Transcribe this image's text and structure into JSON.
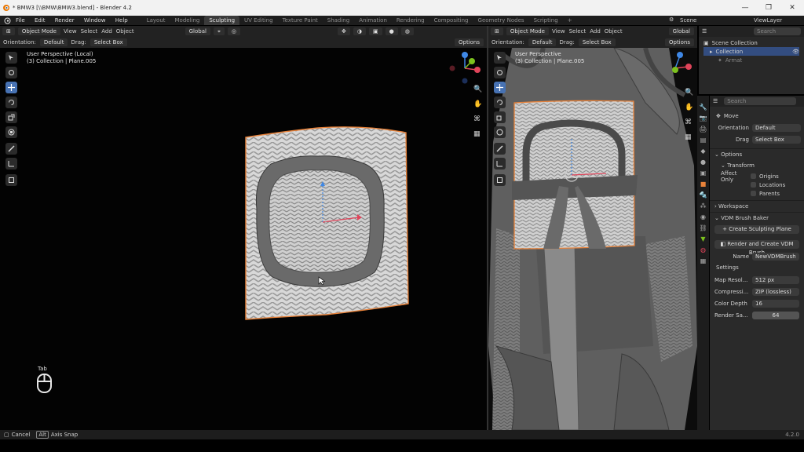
{
  "window": {
    "title": "* BMW3 [\\\\BMW\\BMW3.blend] - Blender 4.2",
    "minimize": "—",
    "maximize": "❐",
    "close": "✕"
  },
  "menubar": {
    "items": [
      "File",
      "Edit",
      "Render",
      "Window",
      "Help"
    ],
    "workspaces": [
      "Layout",
      "Modeling",
      "Sculpting",
      "UV Editing",
      "Texture Paint",
      "Shading",
      "Animation",
      "Rendering",
      "Compositing",
      "Geometry Nodes",
      "Scripting"
    ],
    "active_workspace": "Sculpting",
    "add_tab": "+",
    "scene": "Scene",
    "view_layer": "ViewLayer"
  },
  "left_view": {
    "mode": "Object Mode",
    "menus": [
      "View",
      "Select",
      "Add",
      "Object"
    ],
    "transform": "Global",
    "orientation_label": "Orientation:",
    "orientation_value": "Default",
    "drag_label": "Drag:",
    "drag_value": "Select Box",
    "options": "Options",
    "perspective": "User Perspective (Local)",
    "collection": "(3) Collection | Plane.005",
    "key_hint": "Tab"
  },
  "right_view": {
    "mode": "Object Mode",
    "menus": [
      "View",
      "Select",
      "Add",
      "Object"
    ],
    "transform": "Global",
    "orientation_label": "Orientation:",
    "orientation_value": "Default",
    "drag_label": "Drag:",
    "drag_value": "Select Box",
    "options": "Options",
    "perspective": "User Perspective",
    "collection": "(3) Collection | Plane.005"
  },
  "outliner": {
    "search_placeholder": "Search",
    "scene_collection": "Scene Collection",
    "items": [
      "Collection",
      "Armat"
    ]
  },
  "properties": {
    "search_placeholder": "Search",
    "tool": "Move",
    "orientation_label": "Orientation",
    "orientation_value": "Default",
    "drag_label": "Drag",
    "drag_value": "Select Box",
    "options_header": "Options",
    "transform_header": "Transform",
    "affect_only": "Affect Only",
    "checks": [
      "Origins",
      "Locations",
      "Parents"
    ],
    "workspace_header": "Workspace",
    "vdm_header": "VDM Brush Baker",
    "create_plane_btn": "Create Sculpting Plane",
    "render_create_btn": "Render and Create VDM Brush",
    "name_label": "Name",
    "name_value": "NewVDMBrush",
    "settings_header": "Settings",
    "map_res_label": "Map Resol...",
    "map_res_value": "512 px",
    "compression_label": "Compressi...",
    "compression_value": "ZIP (lossless)",
    "color_depth_label": "Color Depth",
    "color_depth_value": "16",
    "render_samples_label": "Render Sa...",
    "render_samples_value": "64"
  },
  "statusbar": {
    "cancel": "Cancel",
    "alt_key": "Alt",
    "axis_snap": "Axis Snap",
    "version": "4.2.0"
  },
  "colors": {
    "accent": "#4772b3",
    "selection_outline": "#e8823a",
    "x_axis": "#e0445a",
    "y_axis": "#7cc11e",
    "z_axis": "#3f88e6"
  }
}
